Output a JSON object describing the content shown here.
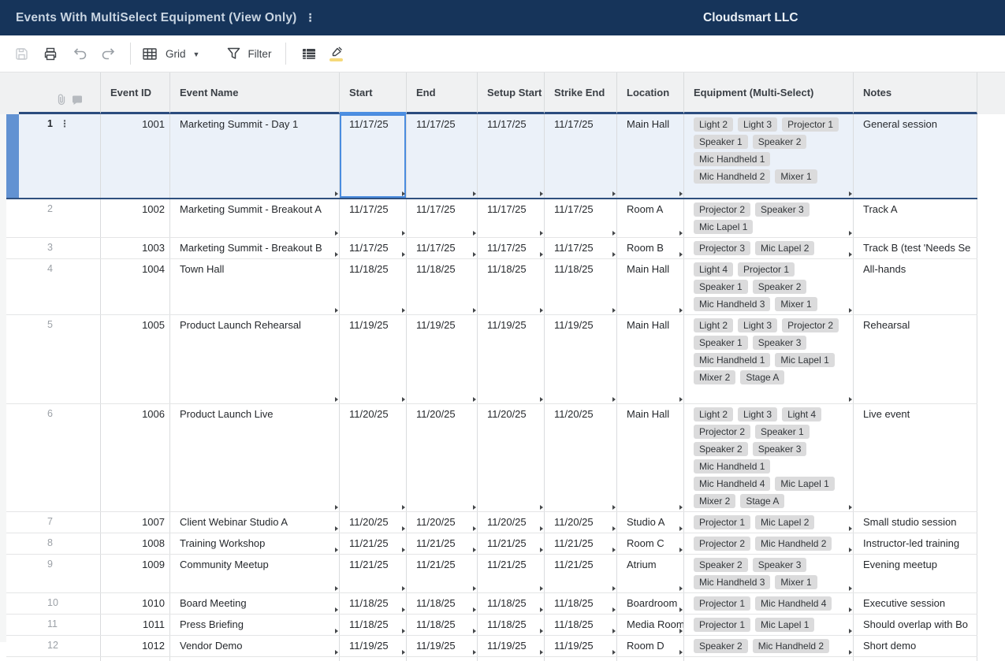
{
  "title_bar": {
    "title": "Events With MultiSelect Equipment (View Only)",
    "menu_icon": "kebab-menu-icon",
    "org": "Cloudsmart LLC"
  },
  "toolbar": {
    "view_selector_label": "Grid",
    "filter_label": "Filter",
    "icons": [
      "save-icon",
      "print-icon",
      "undo-icon",
      "redo-icon",
      "grid-view-icon",
      "dropdown-caret-icon",
      "filter-icon",
      "table-rows-icon",
      "highlighter-icon"
    ]
  },
  "grid": {
    "gutter_icons": [
      "attachment-icon",
      "comment-icon"
    ],
    "columns": [
      {
        "key": "event_id",
        "label": "Event ID"
      },
      {
        "key": "event_name",
        "label": "Event Name"
      },
      {
        "key": "start",
        "label": "Start"
      },
      {
        "key": "end",
        "label": "End"
      },
      {
        "key": "setup_start",
        "label": "Setup Start"
      },
      {
        "key": "strike_end",
        "label": "Strike End"
      },
      {
        "key": "location",
        "label": "Location"
      },
      {
        "key": "equipment",
        "label": "Equipment (Multi-Select)"
      },
      {
        "key": "notes",
        "label": "Notes"
      }
    ],
    "rows": [
      {
        "num": "1",
        "selected": true,
        "event_id": "1001",
        "event_name": "Marketing Summit - Day 1",
        "start": "11/17/25",
        "end": "11/17/25",
        "setup_start": "11/17/25",
        "strike_end": "11/17/25",
        "location": "Main Hall",
        "equipment": [
          [
            "Light 2",
            "Light 3",
            "Projector 1"
          ],
          [
            "Speaker 1",
            "Speaker 2"
          ],
          [
            "Mic Handheld 1"
          ],
          [
            "Mic Handheld 2",
            "Mixer 1"
          ]
        ],
        "notes": "General session"
      },
      {
        "num": "2",
        "selected": false,
        "event_id": "1002",
        "event_name": "Marketing Summit - Breakout A",
        "start": "11/17/25",
        "end": "11/17/25",
        "setup_start": "11/17/25",
        "strike_end": "11/17/25",
        "location": "Room A",
        "equipment": [
          [
            "Projector 2",
            "Speaker 3"
          ],
          [
            "Mic Lapel 1"
          ]
        ],
        "notes": "Track A"
      },
      {
        "num": "3",
        "selected": false,
        "event_id": "1003",
        "event_name": "Marketing Summit - Breakout B",
        "start": "11/17/25",
        "end": "11/17/25",
        "setup_start": "11/17/25",
        "strike_end": "11/17/25",
        "location": "Room B",
        "equipment": [
          [
            "Projector 3",
            "Mic Lapel 2"
          ]
        ],
        "notes": "Track B (test 'Needs Se"
      },
      {
        "num": "4",
        "selected": false,
        "event_id": "1004",
        "event_name": "Town Hall",
        "start": "11/18/25",
        "end": "11/18/25",
        "setup_start": "11/18/25",
        "strike_end": "11/18/25",
        "location": "Main Hall",
        "equipment": [
          [
            "Light 4",
            "Projector 1"
          ],
          [
            "Speaker 1",
            "Speaker 2"
          ],
          [
            "Mic Handheld 3",
            "Mixer 1"
          ]
        ],
        "notes": "All-hands"
      },
      {
        "num": "5",
        "selected": false,
        "event_id": "1005",
        "event_name": "Product Launch Rehearsal",
        "start": "11/19/25",
        "end": "11/19/25",
        "setup_start": "11/19/25",
        "strike_end": "11/19/25",
        "location": "Main Hall",
        "equipment": [
          [
            "Light 2",
            "Light 3",
            "Projector 2"
          ],
          [
            "Speaker 1",
            "Speaker 3"
          ],
          [
            "Mic Handheld 1",
            "Mic Lapel 1"
          ],
          [
            "Mixer 2",
            "Stage A"
          ]
        ],
        "notes": "Rehearsal"
      },
      {
        "num": "6",
        "selected": false,
        "event_id": "1006",
        "event_name": "Product Launch Live",
        "start": "11/20/25",
        "end": "11/20/25",
        "setup_start": "11/20/25",
        "strike_end": "11/20/25",
        "location": "Main Hall",
        "equipment": [
          [
            "Light 2",
            "Light 3",
            "Light 4"
          ],
          [
            "Projector 2",
            "Speaker 1"
          ],
          [
            "Speaker 2",
            "Speaker 3"
          ],
          [
            "Mic Handheld 1"
          ],
          [
            "Mic Handheld 4",
            "Mic Lapel 1"
          ],
          [
            "Mixer 2",
            "Stage A"
          ]
        ],
        "notes": "Live event"
      },
      {
        "num": "7",
        "selected": false,
        "event_id": "1007",
        "event_name": "Client Webinar Studio A",
        "start": "11/20/25",
        "end": "11/20/25",
        "setup_start": "11/20/25",
        "strike_end": "11/20/25",
        "location": "Studio A",
        "equipment": [
          [
            "Projector 1",
            "Mic Lapel 2"
          ]
        ],
        "notes": "Small studio session"
      },
      {
        "num": "8",
        "selected": false,
        "event_id": "1008",
        "event_name": "Training Workshop",
        "start": "11/21/25",
        "end": "11/21/25",
        "setup_start": "11/21/25",
        "strike_end": "11/21/25",
        "location": "Room C",
        "equipment": [
          [
            "Projector 2",
            "Mic Handheld 2"
          ]
        ],
        "notes": "Instructor-led training"
      },
      {
        "num": "9",
        "selected": false,
        "event_id": "1009",
        "event_name": "Community Meetup",
        "start": "11/21/25",
        "end": "11/21/25",
        "setup_start": "11/21/25",
        "strike_end": "11/21/25",
        "location": "Atrium",
        "equipment": [
          [
            "Speaker 2",
            "Speaker 3"
          ],
          [
            "Mic Handheld 3",
            "Mixer 1"
          ]
        ],
        "notes": "Evening meetup"
      },
      {
        "num": "10",
        "selected": false,
        "event_id": "1010",
        "event_name": "Board Meeting",
        "start": "11/18/25",
        "end": "11/18/25",
        "setup_start": "11/18/25",
        "strike_end": "11/18/25",
        "location": "Boardroom",
        "equipment": [
          [
            "Projector 1",
            "Mic Handheld 4"
          ]
        ],
        "notes": "Executive session"
      },
      {
        "num": "11",
        "selected": false,
        "event_id": "1011",
        "event_name": "Press Briefing",
        "start": "11/18/25",
        "end": "11/18/25",
        "setup_start": "11/18/25",
        "strike_end": "11/18/25",
        "location": "Media Room",
        "equipment": [
          [
            "Projector 1",
            "Mic Lapel 1"
          ]
        ],
        "notes": "Should overlap with Bo"
      },
      {
        "num": "12",
        "selected": false,
        "event_id": "1012",
        "event_name": "Vendor Demo",
        "start": "11/19/25",
        "end": "11/19/25",
        "setup_start": "11/19/25",
        "strike_end": "11/19/25",
        "location": "Room D",
        "equipment": [
          [
            "Speaker 2",
            "Mic Handheld 2"
          ]
        ],
        "notes": "Short demo"
      }
    ]
  },
  "colors": {
    "top_bar": "#16345A",
    "header_bg": "#F0F1F2",
    "header_border": "#2B4C7E",
    "active_cell_blue": "#4A8CDF",
    "selected_row_bg": "#EBF1F9",
    "selection_bar": "#6292D2",
    "chip_bg": "#DBDBDC",
    "highlight_yellow": "#F6D97A"
  }
}
